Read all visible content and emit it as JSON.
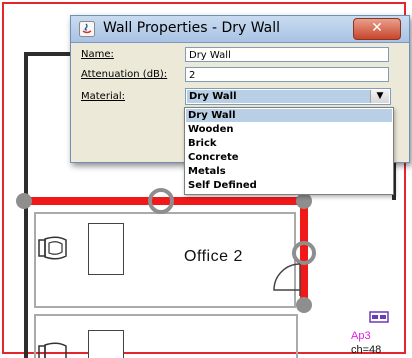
{
  "dialog": {
    "title": "Wall Properties - Dry Wall",
    "close_symbol": "✕",
    "name_label": "Name:",
    "name_value": "Dry Wall",
    "attenuation_label": "Attenuation (dB):",
    "attenuation_value": "2",
    "material_label": "Material:",
    "material_value": "Dry Wall",
    "material_options": [
      "Dry Wall",
      "Wooden",
      "Brick",
      "Concrete",
      "Metals",
      "Self Defined"
    ]
  },
  "floorplan": {
    "room_label": "Office 2",
    "access_point": {
      "name": "Ap3",
      "channel": "ch=48"
    }
  },
  "colors": {
    "selected_wall": "#f01818",
    "frame": "#e3262e",
    "access_point": "#e020e0"
  }
}
